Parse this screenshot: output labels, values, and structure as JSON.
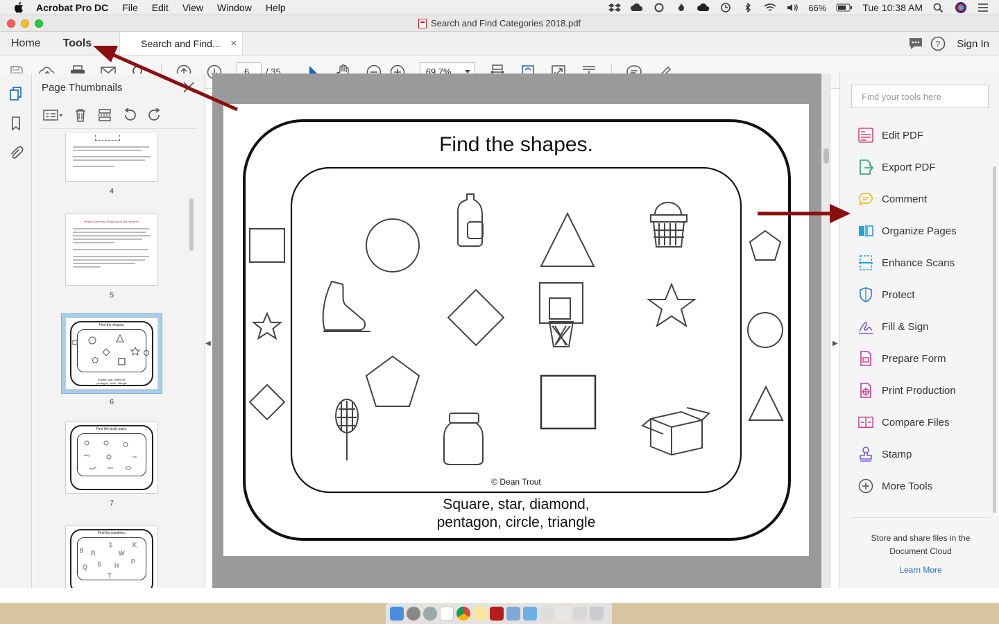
{
  "menubar": {
    "app_name": "Acrobat Pro DC",
    "items": [
      "File",
      "Edit",
      "View",
      "Window",
      "Help"
    ],
    "battery": "66%",
    "clock": "Tue 10:38 AM"
  },
  "window": {
    "title": "Search and Find Categories 2018.pdf"
  },
  "tabbar": {
    "home": "Home",
    "tools": "Tools",
    "doc_tab": "Search and Find...",
    "close": "×",
    "sign_in": "Sign In"
  },
  "toolbar": {
    "page_current": "6",
    "page_total": "/ 35",
    "zoom": "69.7%"
  },
  "thumbnails": {
    "title": "Page Thumbnails",
    "items": [
      {
        "label": "4"
      },
      {
        "label": "5",
        "heading": "Please note these things about this resource:"
      },
      {
        "label": "6",
        "heading": "Find the shapes."
      },
      {
        "label": "7",
        "heading": "Find the body parts."
      },
      {
        "label": "",
        "heading": "Find the numbers."
      }
    ]
  },
  "document": {
    "heading": "Find the shapes.",
    "credit": "© Dean Trout",
    "caption_line1": "Square, star, diamond,",
    "caption_line2": "pentagon, circle, triangle"
  },
  "tools_pane": {
    "search_placeholder": "Find your tools here",
    "tools": [
      {
        "label": "Edit PDF",
        "icon": "edit-pdf-icon",
        "color": "#e0457b"
      },
      {
        "label": "Export PDF",
        "icon": "export-pdf-icon",
        "color": "#2a9d6e"
      },
      {
        "label": "Comment",
        "icon": "comment-icon",
        "color": "#f0b400"
      },
      {
        "label": "Organize Pages",
        "icon": "organize-pages-icon",
        "color": "#1ea4d6"
      },
      {
        "label": "Enhance Scans",
        "icon": "enhance-scans-icon",
        "color": "#1ea4d6"
      },
      {
        "label": "Protect",
        "icon": "protect-icon",
        "color": "#2b7bd6"
      },
      {
        "label": "Fill & Sign",
        "icon": "fill-sign-icon",
        "color": "#7a5cd6"
      },
      {
        "label": "Prepare Form",
        "icon": "prepare-form-icon",
        "color": "#c2408f"
      },
      {
        "label": "Print Production",
        "icon": "print-production-icon",
        "color": "#c2408f"
      },
      {
        "label": "Compare Files",
        "icon": "compare-files-icon",
        "color": "#c2408f"
      },
      {
        "label": "Stamp",
        "icon": "stamp-icon",
        "color": "#7a5cd6"
      },
      {
        "label": "More Tools",
        "icon": "more-tools-icon",
        "color": "#555555"
      }
    ],
    "cloud_text": "Store and share files in the Document Cloud",
    "learn_more": "Learn More"
  },
  "colors": {
    "annotation_arrow": "#8b0f0f",
    "selection": "#a9cfe8",
    "link": "#1c6fd2"
  }
}
